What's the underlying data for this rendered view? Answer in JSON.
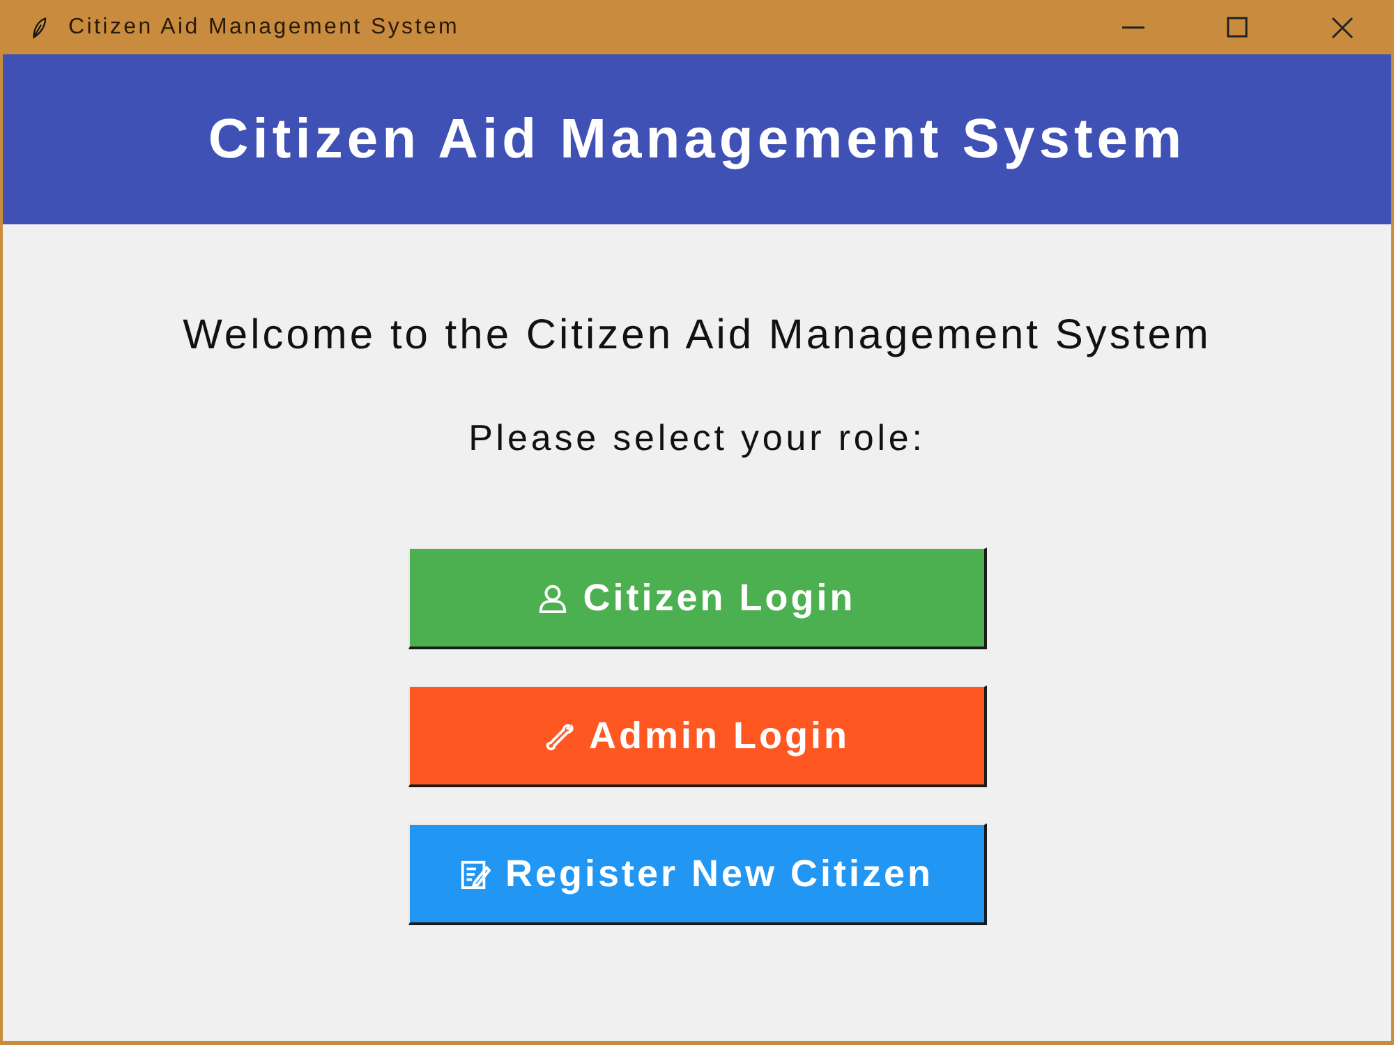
{
  "window": {
    "title": "Citizen Aid Management System"
  },
  "header": {
    "title": "Citizen Aid Management System"
  },
  "welcome": "Welcome to the Citizen Aid Management System",
  "prompt": "Please select your role:",
  "buttons": [
    {
      "label": "Citizen Login",
      "color": "#4caf50"
    },
    {
      "label": "Admin Login",
      "color": "#ff5722"
    },
    {
      "label": "Register New Citizen",
      "color": "#2196f3"
    }
  ]
}
